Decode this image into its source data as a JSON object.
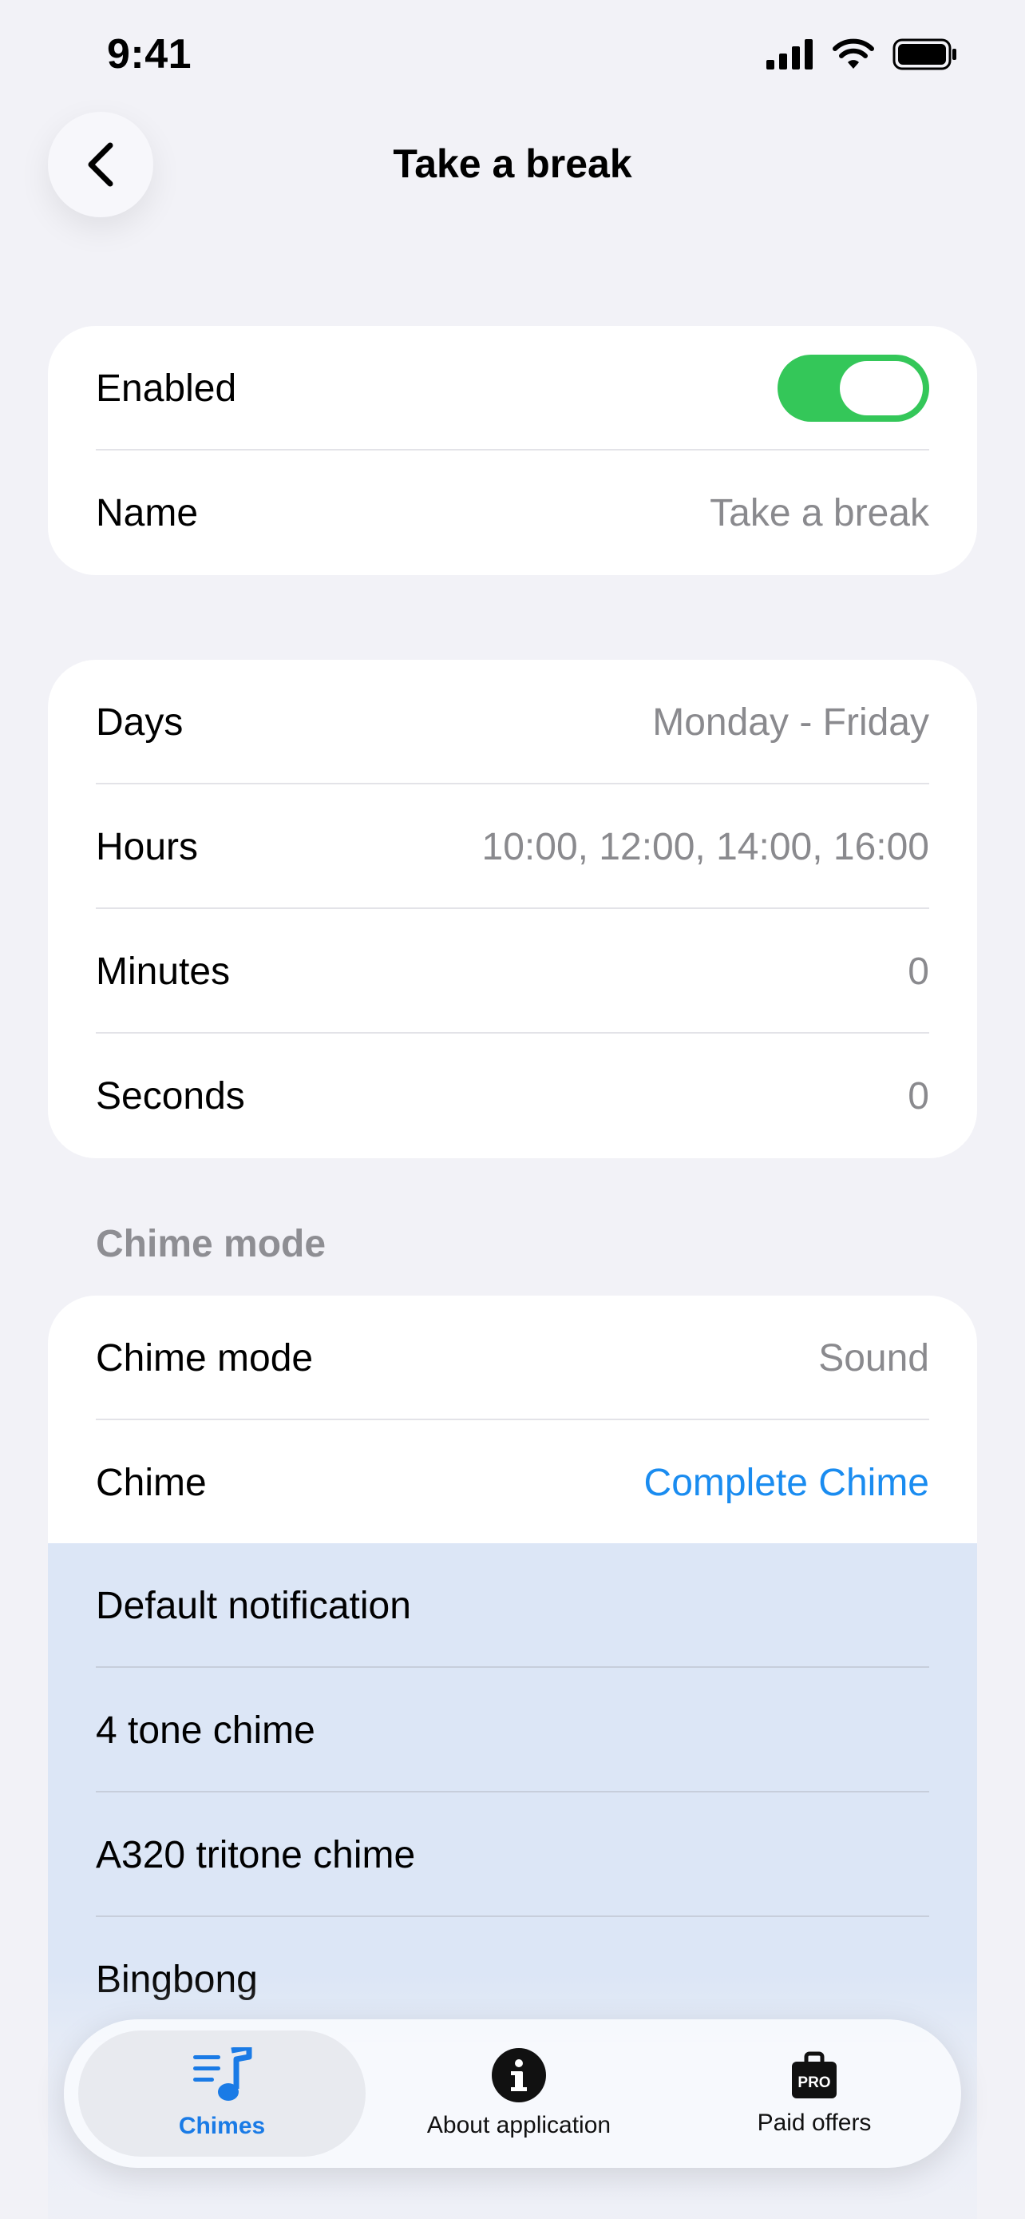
{
  "status_bar": {
    "time": "9:41"
  },
  "nav": {
    "title": "Take a break"
  },
  "general": {
    "enabled_label": "Enabled",
    "enabled": true,
    "name_label": "Name",
    "name_value": "Take a break"
  },
  "schedule": [
    {
      "label": "Days",
      "value": "Monday - Friday"
    },
    {
      "label": "Hours",
      "value": "10:00, 12:00, 14:00, 16:00"
    },
    {
      "label": "Minutes",
      "value": "0"
    },
    {
      "label": "Seconds",
      "value": "0"
    }
  ],
  "chime_section": {
    "header": "Chime mode",
    "mode_label": "Chime mode",
    "mode_value": "Sound",
    "chime_label": "Chime",
    "chime_value": "Complete Chime"
  },
  "chime_options": [
    "Default notification",
    "4 tone chime",
    "A320 tritone chime",
    "Bingbong"
  ],
  "tab_bar": {
    "tabs": [
      {
        "label": "Chimes",
        "icon": "music-list-icon",
        "active": true
      },
      {
        "label": "About application",
        "icon": "info-icon",
        "active": false
      },
      {
        "label": "Paid offers",
        "icon": "pro-bag-icon",
        "active": false
      }
    ]
  },
  "colors": {
    "accent": "#1a8cf0",
    "toggle_on": "#34c759",
    "dropdown_bg": "#dce6f6"
  }
}
